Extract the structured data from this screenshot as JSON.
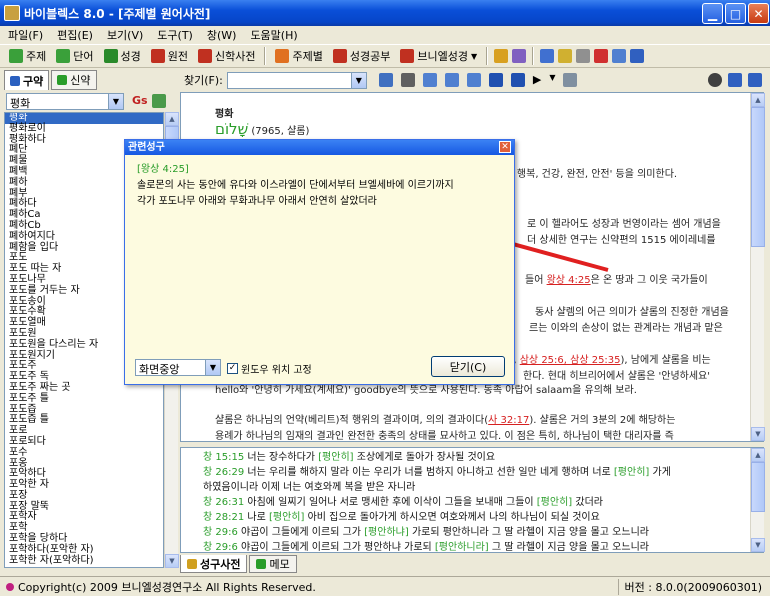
{
  "window": {
    "title": "바이블렉스 8.0 - [주제별 원어사전]"
  },
  "menu": [
    "파일(F)",
    "편집(E)",
    "보기(V)",
    "도구(T)",
    "창(W)",
    "도움말(H)"
  ],
  "toolbar": [
    {
      "label": "주제",
      "color": "#3aa03a"
    },
    {
      "label": "단어",
      "color": "#3aa03a"
    },
    {
      "label": "성경",
      "color": "#c03020"
    },
    {
      "label": "원전",
      "color": "#c03020"
    },
    {
      "label": "신학사전",
      "color": "#c03020"
    },
    {
      "label": "주제별",
      "color": "#e07020"
    },
    {
      "label": "성경공부",
      "color": "#c03020"
    },
    {
      "label": "브니엘성경",
      "color": "#c03020"
    }
  ],
  "left_tabs": [
    "구약",
    "신약"
  ],
  "search": {
    "value": "평화",
    "g_label": "Gs"
  },
  "word_list": [
    "평화",
    "평화로이",
    "평화하다",
    "폐단",
    "폐물",
    "폐백",
    "폐하",
    "폐부",
    "폐하다",
    "폐하Ca",
    "폐하Cb",
    "폐하여지다",
    "폐함을 입다",
    "포도",
    "포도 따는 자",
    "포도나무",
    "포도를 거두는 자",
    "포도송이",
    "포도수확",
    "포도열매",
    "포도원",
    "포도원을 다스리는 자",
    "포도원지기",
    "포도주",
    "포도주 독",
    "포도주 짜는 곳",
    "포도주 틀",
    "포도즙",
    "포도즙 틀",
    "포로",
    "포로되다",
    "포수",
    "포옹",
    "포악하다",
    "포악한 자",
    "포장",
    "포장 말뚝",
    "포학자",
    "포학",
    "포학을 당하다",
    "포학하다(포악한 자)",
    "포학한 자(포악하다)"
  ],
  "find": {
    "label": "찾기(F):"
  },
  "main": {
    "heading": "평화",
    "hebrew": "שָׁלוֹם",
    "hebrew_note": "(7965, 샬롬)",
    "lines": [
      {
        "pre": "",
        "ref": "",
        "post": "' 행복, 건강, 완전, 안전' 등을 의미한다."
      },
      {
        "pre": "",
        "ref": "",
        "post": "로 이 헬라어도 성장과 번영이라는 셈어 개념을"
      },
      {
        "pre": "",
        "ref": "",
        "post": "더 상세한 연구는 신약편의 1515 에이레네를"
      },
      {
        "pre": "",
        "ref": "",
        "post": ""
      },
      {
        "pre": "들어 ",
        "ref": "왕상 4:25",
        "post": "은 온 땅과 그 이웃 국가들이"
      },
      {
        "pre": "",
        "ref": "",
        "post": ""
      },
      {
        "pre": "",
        "ref": "",
        "post": "동사 샬렘의 어근 의미가 샬롬의 진정한 개념을"
      },
      {
        "pre": "",
        "ref": "",
        "post": "르는 이와의 손상이 없는 관계라는 개념과 맡은"
      },
      {
        "pre": "",
        "ref": "",
        "post": ""
      },
      {
        "pre": "",
        "ref": "",
        "post": ""
      },
      {
        "pre": "5, ",
        "ref": "삼상 25:6, 삼상 25:35",
        "post": "), 남에게 샬롬을 비는"
      },
      {
        "pre": "",
        "ref": "",
        "post": "한다. 현대 히브리어에서 샬롬은 '안녕하세요'"
      },
      {
        "pre": "hello와 '안녕히 가세요(계세요)' goodbye의 뜻으로 사용된다. 동족 아랍어 salaam을 유의해 보라.",
        "ref": "",
        "post": ""
      },
      {
        "pre": "",
        "ref": "",
        "post": ""
      },
      {
        "pre": "샬롬은 하나님의 언약(베리트)적 행위의 결과이며, 의의 결과이다(",
        "ref": "사 32:17",
        "post": "). 샬롬은 거의 3분의 2에 해당하는"
      },
      {
        "pre": "용례가 하나님의 임재의 결과인 완전한 충족의 상태를 묘사하고 있다. 이 점은 특히, 하나님이 택한 대리자를 즉",
        "ref": "",
        "post": ""
      }
    ]
  },
  "verses": [
    {
      "ref": "창 15:15",
      "a": "너는 장수하다가 ",
      "hl": "[평안히]",
      "b": " 조상에게로 돌아가 장사될 것이요"
    },
    {
      "ref": "창 26:29",
      "a": "너는 우리를 해하지 말라 이는 우리가 너를 범하지 아니하고 선한 일만 네게 행하며 너로 ",
      "hl": "[평안히]",
      "b": " 가게"
    },
    {
      "ref": "",
      "a": "하였음이니라 이제 너는 여호와께 복을 받은 자니라",
      "hl": "",
      "b": ""
    },
    {
      "ref": "창 26:31",
      "a": "아침에 일찌기 일어나 서로 맹세한 후에 이삭이 그들을 보내매 그들이 ",
      "hl": "[평안히]",
      "b": " 갔더라"
    },
    {
      "ref": "창 28:21",
      "a": "나로 ",
      "hl": "[평안히]",
      "b": " 아비 집으로 돌아가게 하시오면 여호와께서 나의 하나님이 되실 것이요"
    },
    {
      "ref": "창 29:6",
      "a": "야곱이 그들에게 이르되 그가 ",
      "hl": "[평안하냐]",
      "b": " 가로되 평안하니라 그 딸 라헬이 지금 양을 몰고 오느니라"
    },
    {
      "ref": "창 29:6",
      "a": "야곱이 그들에게 이르되 그가 평안하냐 가로되 ",
      "hl": "[평안하니라]",
      "b": " 그 딸 라헬이 지금 양을 몰고 오느니라"
    }
  ],
  "bottom_tabs": [
    "성구사전",
    "메모"
  ],
  "status": {
    "left": "Copyright(c) 2009 브니엘성경연구소 All Rights Reserved.",
    "right": "버전 : 8.0.0(2009060301)"
  },
  "dialog": {
    "title": "관련성구",
    "ref": "[왕상 4:25]",
    "line1": "솔로몬의 사는 동안에 유다와 이스라엘이 단에서부터 브엘세바에 이르기까지",
    "line2": "각가 포도나무 아래와 무화과나무 아래서 안연히 살았더라",
    "position_select": "화면중앙",
    "checkbox_label": "윈도우 위치 고정",
    "close_button": "닫기(C)"
  },
  "colors": {
    "accent": "#0a4fd8",
    "reference": "#2a9d2a",
    "link": "#d62020",
    "annotation_arrow": "#e02020"
  }
}
